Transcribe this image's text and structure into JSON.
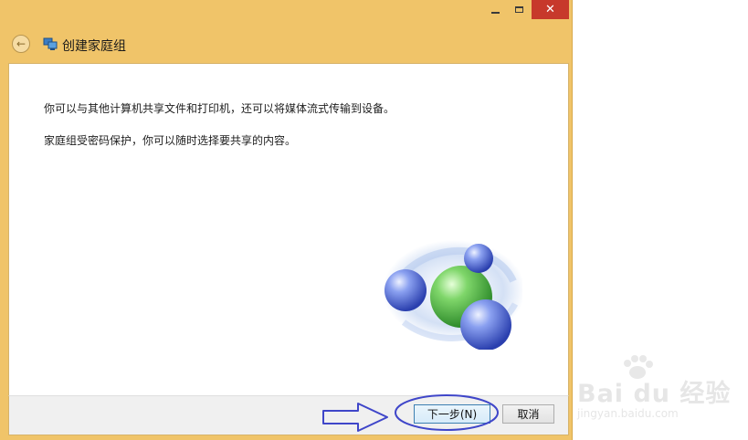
{
  "window": {
    "title": "创建家庭组",
    "controls": {
      "minimize": "minimize-icon",
      "maximize": "maximize-icon",
      "close": "close-icon",
      "close_glyph": "✕"
    },
    "back_button": "back-arrow-icon",
    "back_glyph": "←"
  },
  "content": {
    "paragraph1": "你可以与其他计算机共享文件和打印机，还可以将媒体流式传输到设备。",
    "paragraph2": "家庭组受密码保护，你可以随时选择要共享的内容。",
    "illustration": "homegroup-logo"
  },
  "footer": {
    "next_label": "下一步(N)",
    "cancel_label": "取消"
  },
  "watermark": {
    "text": "Bai du 经验",
    "sub": "jingyan.baidu.com"
  },
  "colors": {
    "frame": "#f0c469",
    "close": "#c7392b",
    "annotation": "#3f46c9"
  }
}
